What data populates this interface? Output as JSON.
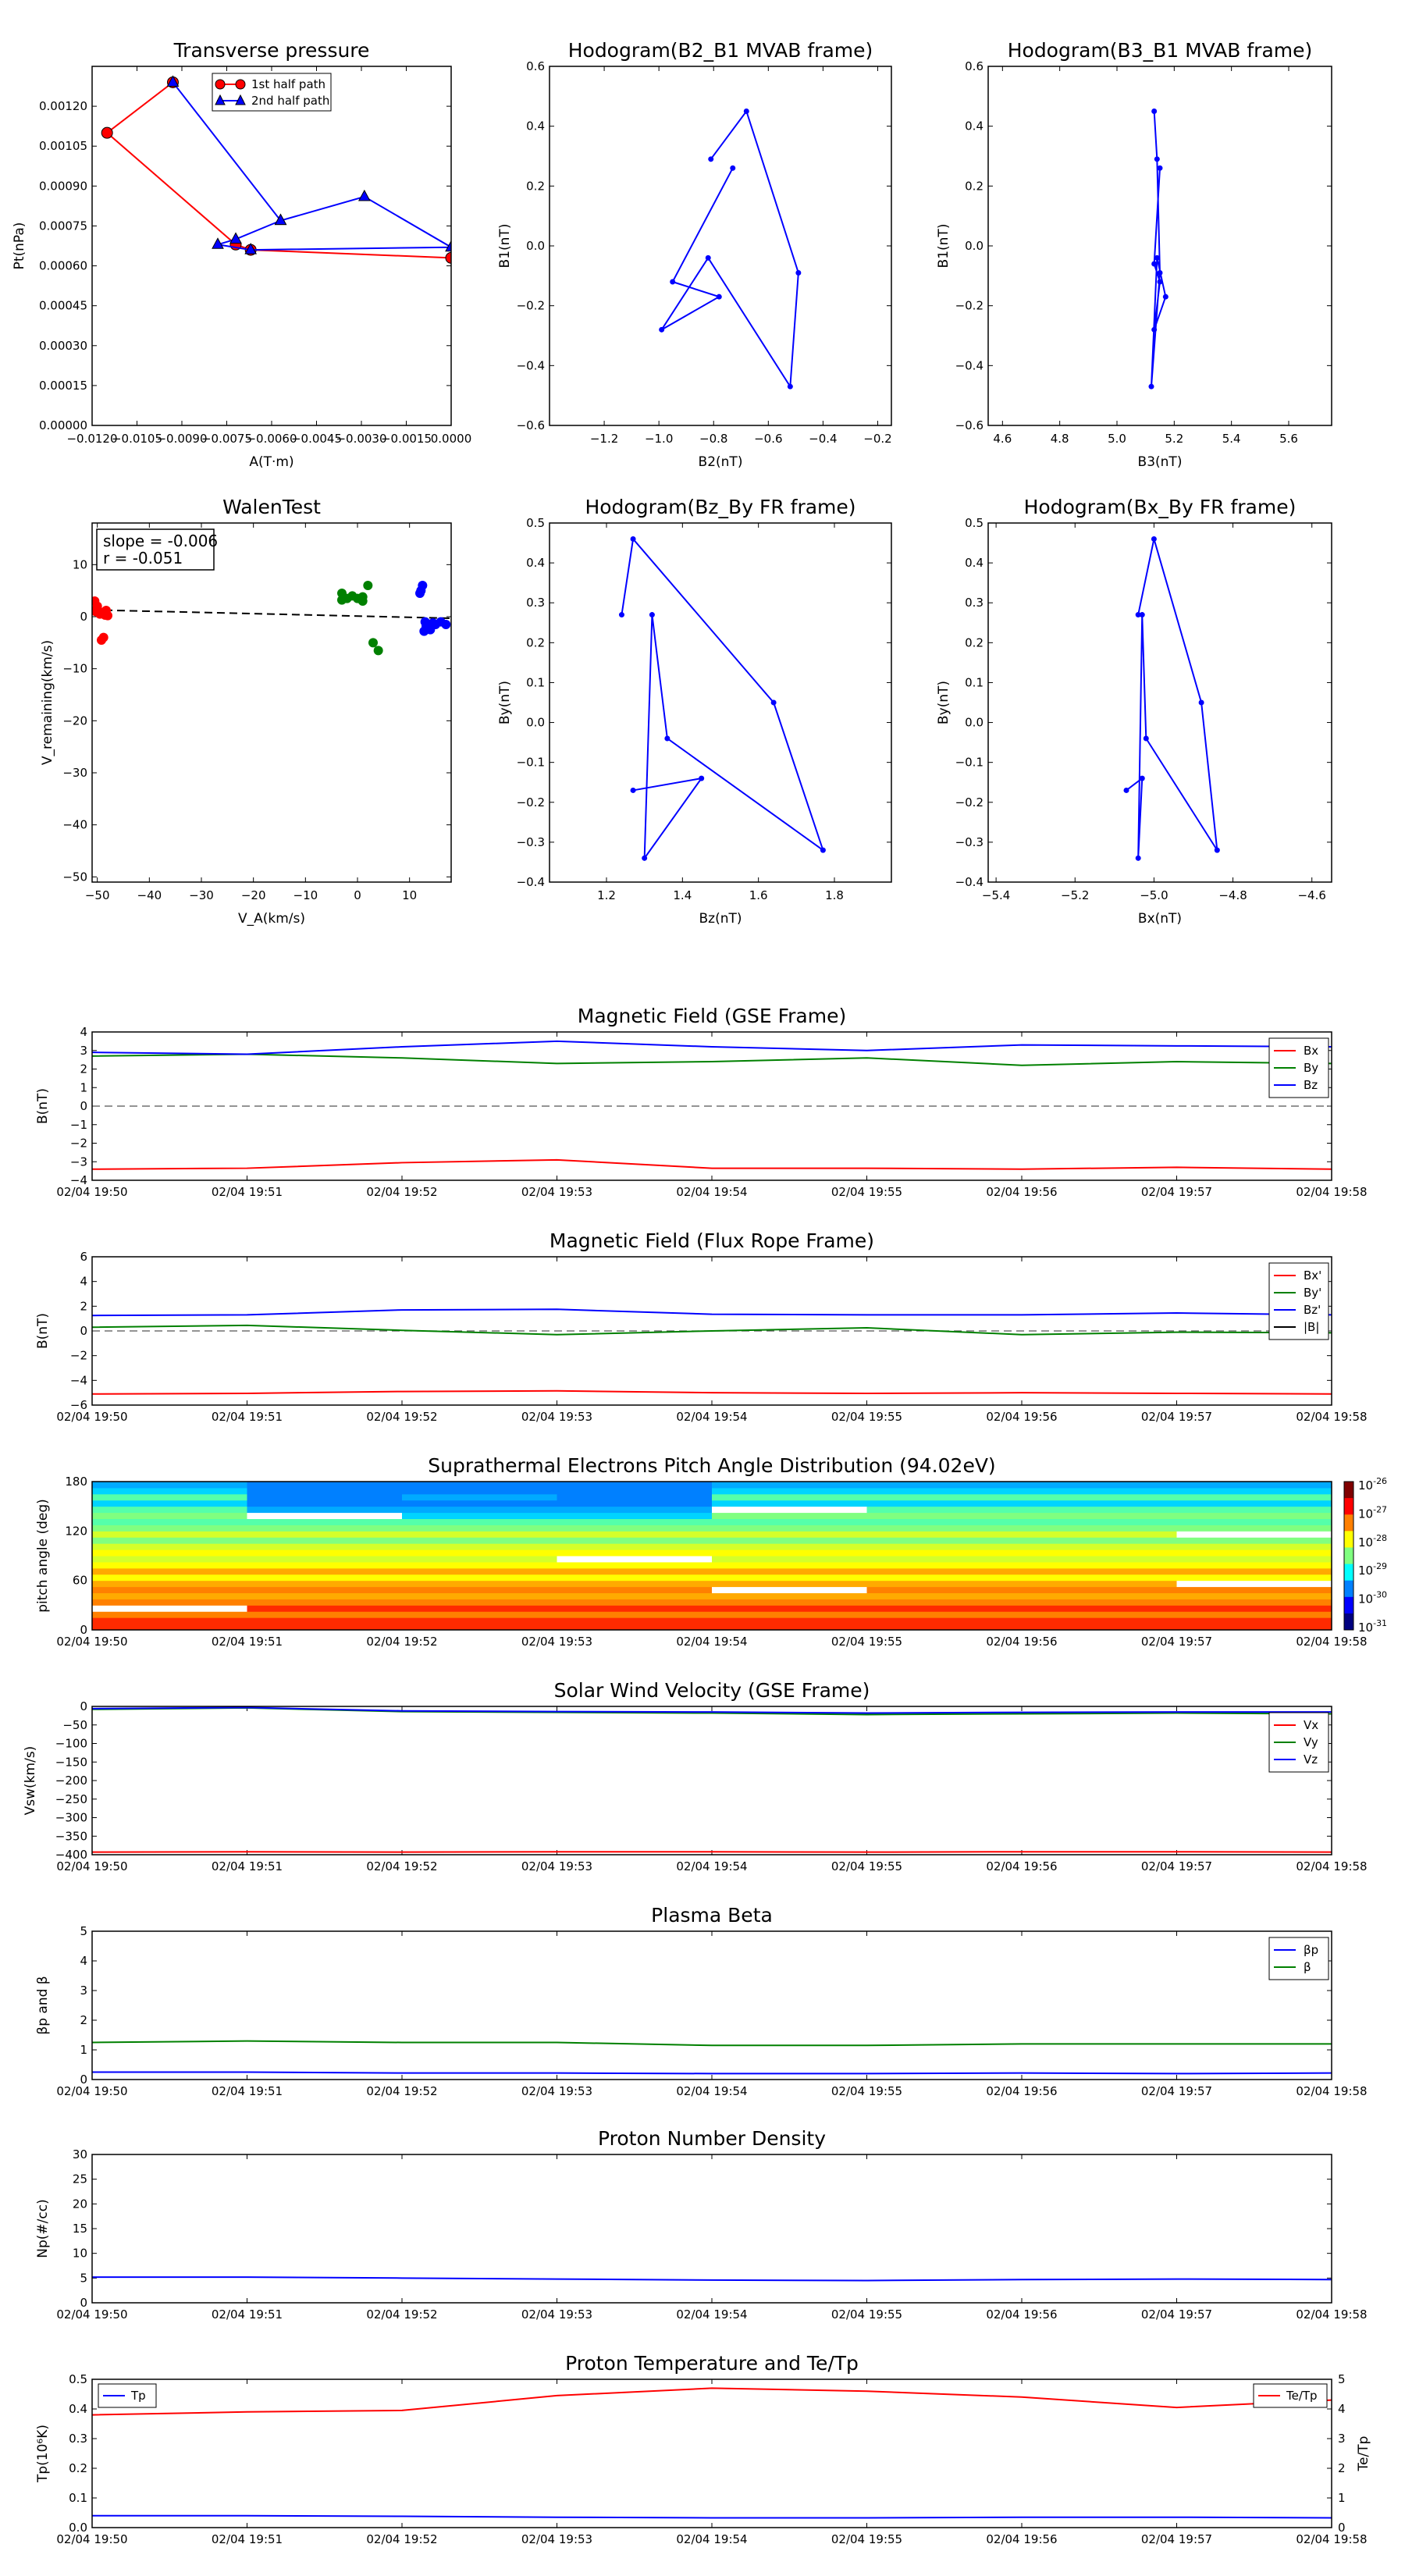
{
  "chart_data": [
    {
      "id": "tp",
      "type": "line",
      "title": "Transverse pressure",
      "xlabel": "A(T·m)",
      "ylabel": "Pt(nPa)",
      "xlim": [
        -0.012,
        0.0
      ],
      "ylim": [
        0.0,
        0.00135
      ],
      "xticks": [
        "−0.0120",
        "−0.0105",
        "−0.0090",
        "−0.0075",
        "−0.0060",
        "−0.0045",
        "−0.0030",
        "−0.0015",
        "0.0000"
      ],
      "yticks": [
        "0.00000",
        "0.00015",
        "0.00030",
        "0.00045",
        "0.00060",
        "0.00075",
        "0.00090",
        "0.00105",
        "0.00120"
      ],
      "series": [
        {
          "name": "1st half path",
          "color": "#ff0000",
          "marker": "circle",
          "x": [
            -0.0093,
            -0.0115,
            -0.0072,
            -0.0067,
            0.0
          ],
          "y": [
            0.00129,
            0.0011,
            0.00068,
            0.00066,
            0.00063
          ]
        },
        {
          "name": "2nd half path",
          "color": "#0000ff",
          "marker": "triangle",
          "x": [
            -0.0093,
            -0.0057,
            -0.0029,
            0.0,
            -0.0067,
            -0.0078,
            -0.0072,
            -0.0057
          ],
          "y": [
            0.00129,
            0.00077,
            0.00086,
            0.00067,
            0.00066,
            0.00068,
            0.0007,
            0.00077
          ]
        }
      ],
      "legend": "top-right"
    },
    {
      "id": "hod1",
      "type": "line",
      "title": "Hodogram(B2_B1 MVAB frame)",
      "xlabel": "B2(nT)",
      "ylabel": "B1(nT)",
      "xlim": [
        -1.4,
        -0.15
      ],
      "ylim": [
        -0.6,
        0.6
      ],
      "xticks": [
        "−1.2",
        "−1.0",
        "−0.8",
        "−0.6",
        "−0.4",
        "−0.2"
      ],
      "yticks": [
        "−0.6",
        "−0.4",
        "−0.2",
        "0.0",
        "0.2",
        "0.4",
        "0.6"
      ],
      "series": [
        {
          "color": "#0000ff",
          "x": [
            -0.81,
            -0.68,
            -0.49,
            -0.52,
            -0.82,
            -0.99,
            -0.78,
            -0.95,
            -0.73
          ],
          "y": [
            0.29,
            0.45,
            -0.09,
            -0.47,
            -0.04,
            -0.28,
            -0.17,
            -0.12,
            0.26
          ]
        }
      ]
    },
    {
      "id": "hod2",
      "type": "line",
      "title": "Hodogram(B3_B1 MVAB frame)",
      "xlabel": "B3(nT)",
      "ylabel": "B1(nT)",
      "xlim": [
        4.55,
        5.75
      ],
      "ylim": [
        -0.6,
        0.6
      ],
      "xticks": [
        "4.6",
        "4.8",
        "5.0",
        "5.2",
        "5.4",
        "5.6"
      ],
      "yticks": [
        "−0.6",
        "−0.4",
        "−0.2",
        "0.0",
        "0.2",
        "0.4",
        "0.6"
      ],
      "series": [
        {
          "color": "#0000ff",
          "x": [
            5.13,
            5.14,
            5.15,
            5.12,
            5.14,
            5.17,
            5.13,
            5.15,
            5.13,
            5.15
          ],
          "y": [
            0.45,
            0.29,
            -0.09,
            -0.47,
            -0.04,
            -0.17,
            -0.28,
            -0.12,
            -0.06,
            0.26
          ]
        }
      ]
    },
    {
      "id": "walen",
      "type": "scatter",
      "title": "WalenTest",
      "xlabel": "V_A(km/s)",
      "ylabel": "V_remaining(km/s)",
      "xlim": [
        -51,
        18
      ],
      "ylim": [
        -51,
        18
      ],
      "xticks": [
        "−50",
        "−40",
        "−30",
        "−20",
        "−10",
        "0",
        "10"
      ],
      "yticks": [
        "−50",
        "−40",
        "−30",
        "−20",
        "−10",
        "0",
        "10"
      ],
      "annotation": [
        "slope = -0.006",
        "r = -0.051"
      ],
      "fit_line": {
        "x": [
          -51,
          18
        ],
        "y": [
          1.3,
          -0.3
        ]
      },
      "series": [
        {
          "color": "#ff0000",
          "x": [
            -50.5,
            -50,
            -50.3,
            -49.5,
            -49,
            -48.5,
            -48.3,
            -48,
            -49.2,
            -48.8,
            -49.6,
            -50.1
          ],
          "y": [
            3,
            2,
            1,
            0.5,
            0.8,
            0.3,
            1.2,
            0.2,
            -4.5,
            -4,
            0.7,
            1.5
          ]
        },
        {
          "color": "#008000",
          "x": [
            -3,
            -2,
            -1,
            0,
            1,
            2,
            3,
            4,
            -3,
            1
          ],
          "y": [
            4.5,
            3.5,
            4,
            3.5,
            3,
            6,
            -5,
            -6.5,
            3.2,
            3.8
          ]
        },
        {
          "color": "#0000ff",
          "x": [
            12,
            12.5,
            13,
            13.5,
            14,
            15,
            16,
            17,
            12.8,
            13.2,
            14.5,
            12.2
          ],
          "y": [
            4.5,
            6,
            -1,
            -2,
            -2.5,
            -1.5,
            -1,
            -1.5,
            -2.8,
            -1.8,
            -1.2,
            5
          ]
        }
      ]
    },
    {
      "id": "hod3",
      "type": "line",
      "title": "Hodogram(Bz_By FR frame)",
      "xlabel": "Bz(nT)",
      "ylabel": "By(nT)",
      "xlim": [
        1.05,
        1.95
      ],
      "ylim": [
        -0.4,
        0.5
      ],
      "xticks": [
        "1.2",
        "1.4",
        "1.6",
        "1.8"
      ],
      "yticks": [
        "−0.4",
        "−0.3",
        "−0.2",
        "−0.1",
        "0.0",
        "0.1",
        "0.2",
        "0.3",
        "0.4",
        "0.5"
      ],
      "series": [
        {
          "color": "#0000ff",
          "x": [
            1.24,
            1.27,
            1.64,
            1.77,
            1.36,
            1.32,
            1.3,
            1.45,
            1.27
          ],
          "y": [
            0.27,
            0.46,
            0.05,
            -0.32,
            -0.04,
            0.27,
            -0.34,
            -0.14,
            -0.17
          ]
        }
      ]
    },
    {
      "id": "hod4",
      "type": "line",
      "title": "Hodogram(Bx_By FR frame)",
      "xlabel": "Bx(nT)",
      "ylabel": "By(nT)",
      "xlim": [
        -5.42,
        -4.55
      ],
      "ylim": [
        -0.4,
        0.5
      ],
      "xticks": [
        "−5.4",
        "−5.2",
        "−5.0",
        "−4.8",
        "−4.6"
      ],
      "yticks": [
        "−0.4",
        "−0.3",
        "−0.2",
        "−0.1",
        "0.0",
        "0.1",
        "0.2",
        "0.3",
        "0.4",
        "0.5"
      ],
      "series": [
        {
          "color": "#0000ff",
          "x": [
            -5.04,
            -5.0,
            -4.88,
            -4.84,
            -5.02,
            -5.03,
            -5.04,
            -5.03,
            -5.07
          ],
          "y": [
            0.27,
            0.46,
            0.05,
            -0.32,
            -0.04,
            0.27,
            -0.34,
            -0.14,
            -0.17
          ]
        }
      ]
    }
  ],
  "time_ticks": [
    "02/04 19:50",
    "02/04 19:51",
    "02/04 19:52",
    "02/04 19:53",
    "02/04 19:54",
    "02/04 19:55",
    "02/04 19:56",
    "02/04 19:57",
    "02/04 19:58"
  ],
  "time_series": [
    {
      "id": "bgse",
      "title": "Magnetic Field (GSE Frame)",
      "ylabel": "B(nT)",
      "ylim": [
        -4,
        4
      ],
      "yticks": [
        "−4",
        "−3",
        "−2",
        "−1",
        "0",
        "1",
        "2",
        "3",
        "4"
      ],
      "zero_line": true,
      "legend": "right",
      "series": [
        {
          "name": "Bx",
          "color": "#ff0000",
          "values": [
            -3.4,
            -3.35,
            -3.05,
            -2.9,
            -3.35,
            -3.35,
            -3.4,
            -3.3,
            -3.4
          ]
        },
        {
          "name": "By",
          "color": "#008000",
          "values": [
            2.7,
            2.8,
            2.6,
            2.3,
            2.4,
            2.6,
            2.2,
            2.4,
            2.3
          ]
        },
        {
          "name": "Bz",
          "color": "#0000ff",
          "values": [
            2.9,
            2.8,
            3.2,
            3.5,
            3.2,
            3.0,
            3.3,
            3.25,
            3.2
          ]
        }
      ]
    },
    {
      "id": "bfr",
      "title": "Magnetic Field (Flux Rope Frame)",
      "ylabel": "B(nT)",
      "ylim": [
        -6,
        6
      ],
      "yticks": [
        "−6",
        "−4",
        "−2",
        "0",
        "2",
        "4",
        "6"
      ],
      "zero_line": true,
      "legend": "right",
      "series": [
        {
          "name": "Bx'",
          "color": "#ff0000",
          "values": [
            -5.1,
            -5.05,
            -4.9,
            -4.85,
            -5.0,
            -5.05,
            -5.0,
            -5.05,
            -5.1
          ]
        },
        {
          "name": "By'",
          "color": "#008000",
          "values": [
            0.3,
            0.45,
            0.05,
            -0.3,
            0.0,
            0.25,
            -0.3,
            -0.1,
            -0.15
          ]
        },
        {
          "name": "Bz'",
          "color": "#0000ff",
          "values": [
            1.25,
            1.3,
            1.7,
            1.75,
            1.35,
            1.3,
            1.3,
            1.45,
            1.3
          ]
        },
        {
          "name": "|B|",
          "color": "#000000",
          "values": []
        }
      ]
    },
    {
      "id": "pad",
      "title": "Suprathermal Electrons Pitch Angle Distribution (94.02eV)",
      "ylabel": "pitch angle (deg)",
      "type": "heatmap",
      "ylim": [
        0,
        180
      ],
      "yticks": [
        "0",
        "60",
        "120",
        "180"
      ],
      "colorbar": [
        "10",
        "10",
        "10",
        "10",
        "10",
        "10"
      ],
      "colorbar_exp": [
        "-26",
        "-27",
        "-28",
        "-29",
        "-30",
        "-31"
      ]
    },
    {
      "id": "vsw",
      "title": "Solar Wind Velocity (GSE Frame)",
      "ylabel": "Vsw(km/s)",
      "ylim": [
        -400,
        0
      ],
      "yticks": [
        "−400",
        "−350",
        "−300",
        "−250",
        "−200",
        "−150",
        "−100",
        "−50",
        "0"
      ],
      "zero_line": false,
      "legend": "right",
      "series": [
        {
          "name": "Vx",
          "color": "#ff0000",
          "values": [
            -393,
            -392,
            -393,
            -392,
            -392,
            -393,
            -392,
            -392,
            -393
          ]
        },
        {
          "name": "Vy",
          "color": "#008000",
          "values": [
            -8,
            -4,
            -14,
            -16,
            -18,
            -22,
            -20,
            -18,
            -20
          ]
        },
        {
          "name": "Vz",
          "color": "#0000ff",
          "values": [
            -6,
            -3,
            -12,
            -14,
            -15,
            -18,
            -16,
            -15,
            -15
          ]
        }
      ]
    },
    {
      "id": "beta",
      "title": "Plasma Beta",
      "ylabel": "βp and β",
      "ylim": [
        0,
        5
      ],
      "yticks": [
        "0",
        "1",
        "2",
        "3",
        "4",
        "5"
      ],
      "zero_line": false,
      "legend": "right",
      "series": [
        {
          "name": "βp",
          "color": "#0000ff",
          "values": [
            0.25,
            0.25,
            0.22,
            0.22,
            0.2,
            0.2,
            0.22,
            0.2,
            0.22
          ]
        },
        {
          "name": "β",
          "color": "#008000",
          "values": [
            1.25,
            1.3,
            1.25,
            1.25,
            1.15,
            1.15,
            1.2,
            1.2,
            1.2
          ]
        }
      ]
    },
    {
      "id": "np",
      "title": "Proton Number Density",
      "ylabel": "Np(#/cc)",
      "ylim": [
        0,
        30
      ],
      "yticks": [
        "0",
        "5",
        "10",
        "15",
        "20",
        "25",
        "30"
      ],
      "zero_line": false,
      "legend": "none",
      "series": [
        {
          "name": "Np",
          "color": "#0000ff",
          "values": [
            5.2,
            5.2,
            5.0,
            4.8,
            4.6,
            4.5,
            4.7,
            4.8,
            4.7
          ]
        }
      ]
    },
    {
      "id": "temp",
      "title": "Proton Temperature and Te/Tp",
      "ylabel": "Tp(10⁶K)",
      "ylim": [
        0,
        0.5
      ],
      "yticks": [
        "0.0",
        "0.1",
        "0.2",
        "0.3",
        "0.4",
        "0.5"
      ],
      "ylabel2": "Te/Tp",
      "ylim2": [
        0,
        5
      ],
      "yticks2": [
        "0",
        "1",
        "2",
        "3",
        "4",
        "5"
      ],
      "legend": "top-left",
      "series": [
        {
          "name": "Tp",
          "color": "#0000ff",
          "axis": 1,
          "values": [
            0.04,
            0.04,
            0.038,
            0.035,
            0.033,
            0.033,
            0.035,
            0.035,
            0.033
          ]
        },
        {
          "name": "Te/Tp",
          "color": "#ff0000",
          "axis": 2,
          "values": [
            3.8,
            3.9,
            3.95,
            4.45,
            4.7,
            4.6,
            4.4,
            4.05,
            4.3
          ]
        }
      ]
    }
  ]
}
